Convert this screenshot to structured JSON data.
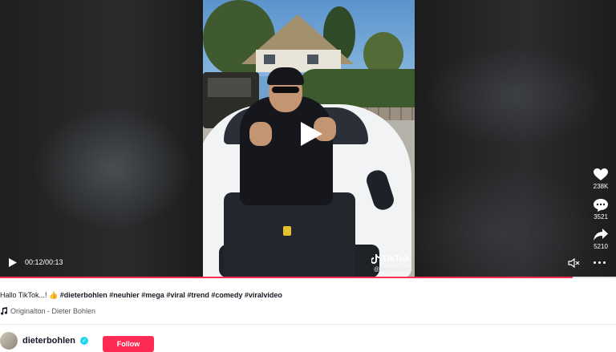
{
  "player": {
    "elapsed_time": "00:12/00:13",
    "progress_fraction": 0.93,
    "watermark_label": "TikTok",
    "watermark_handle": "@dieterbohlen"
  },
  "actions": {
    "likes": "238K",
    "comments": "3521",
    "shares": "5210"
  },
  "caption": {
    "text": "Hallo TikTok...! 👍",
    "hashtags": [
      "#dieterbohlen",
      "#neuhier",
      "#mega",
      "#viral",
      "#trend",
      "#comedy",
      "#viralvideo"
    ]
  },
  "music": {
    "note_icon": "music-note-icon",
    "label": "Originalton - Dieter Bohlen"
  },
  "author": {
    "username": "dieterbohlen",
    "verified": true,
    "follow_label": "Follow"
  },
  "colors": {
    "accent": "#fe2c55",
    "verified": "#20d5ec",
    "player_bg": "#161616"
  }
}
